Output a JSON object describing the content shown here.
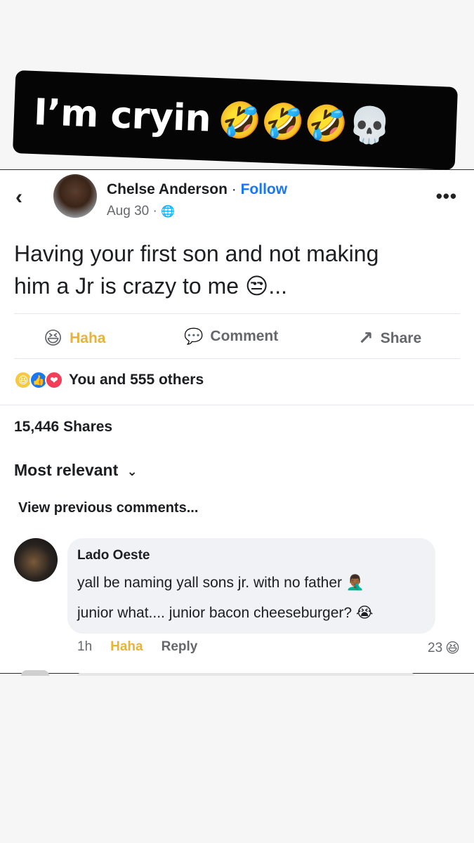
{
  "caption": {
    "text": "I’m cryin",
    "emojis": "🤣🤣🤣💀"
  },
  "post": {
    "back_icon": "‹",
    "author": "Chelse Anderson",
    "separator": " · ",
    "follow_label": "Follow",
    "date": "Aug 30 · ",
    "audience_icon": "🌐",
    "more_icon": "•••",
    "text_line1": "Having your first son and not making",
    "text_line2": "him a Jr is crazy to me 😒...",
    "actions": {
      "haha_icon": "😆",
      "haha_label": "Haha",
      "comment_icon": "💬",
      "comment_label": "Comment",
      "share_icon": "↗",
      "share_label": "Share"
    },
    "reactions": {
      "icons": [
        "😆",
        "👍",
        "❤"
      ],
      "text": "You and 555 others"
    },
    "shares": "15,446 Shares",
    "sort_label": "Most relevant",
    "sort_icon": "⌄",
    "view_previous": "View previous comments..."
  },
  "comment": {
    "author": "Lado Oeste",
    "line1": "yall be naming yall sons jr. with no father 🤦🏾‍♂️",
    "line2": "junior what.... junior bacon cheeseburger? 😭",
    "time": "1h",
    "haha_label": "Haha",
    "reply_label": "Reply",
    "count": "23",
    "count_icon": "😆"
  },
  "colors": {
    "accent": "#1877f2",
    "haha": "#e8b33a",
    "secondary_text": "#65676b"
  }
}
